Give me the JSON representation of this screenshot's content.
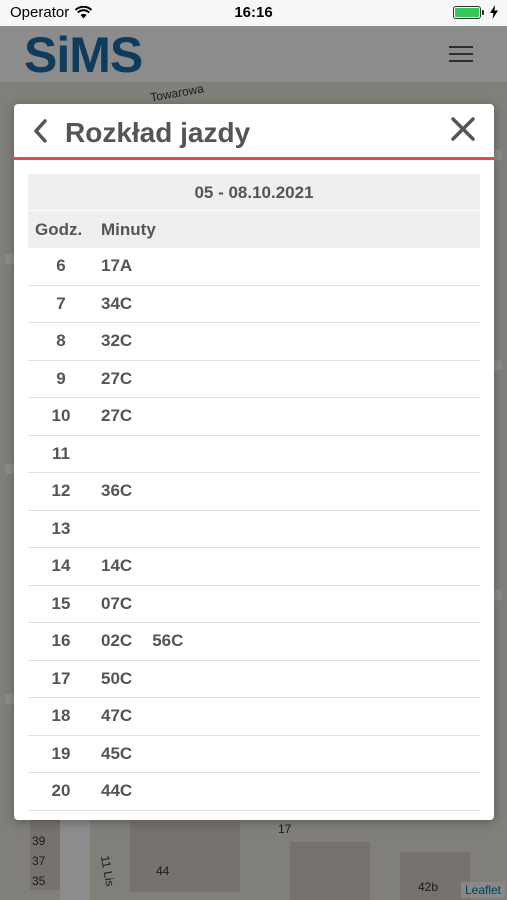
{
  "status_bar": {
    "carrier": "Operator",
    "time": "16:16"
  },
  "app": {
    "logo": "SiMS"
  },
  "map": {
    "street_label": "Towarowa",
    "street_label_2": "11 Lis",
    "house_numbers": [
      "39",
      "37",
      "35",
      "17",
      "44",
      "42b"
    ],
    "attribution": "Leaflet"
  },
  "modal": {
    "title": "Rozkład jazdy",
    "date_range": "05 - 08.10.2021",
    "col_hour": "Godz.",
    "col_minutes": "Minuty",
    "rows": [
      {
        "hour": "6",
        "minutes": [
          "17A"
        ]
      },
      {
        "hour": "7",
        "minutes": [
          "34C"
        ]
      },
      {
        "hour": "8",
        "minutes": [
          "32C"
        ]
      },
      {
        "hour": "9",
        "minutes": [
          "27C"
        ]
      },
      {
        "hour": "10",
        "minutes": [
          "27C"
        ]
      },
      {
        "hour": "11",
        "minutes": []
      },
      {
        "hour": "12",
        "minutes": [
          "36C"
        ]
      },
      {
        "hour": "13",
        "minutes": []
      },
      {
        "hour": "14",
        "minutes": [
          "14C"
        ]
      },
      {
        "hour": "15",
        "minutes": [
          "07C"
        ]
      },
      {
        "hour": "16",
        "minutes": [
          "02C",
          "56C"
        ]
      },
      {
        "hour": "17",
        "minutes": [
          "50C"
        ]
      },
      {
        "hour": "18",
        "minutes": [
          "47C"
        ]
      },
      {
        "hour": "19",
        "minutes": [
          "45C"
        ]
      },
      {
        "hour": "20",
        "minutes": [
          "44C"
        ]
      }
    ]
  },
  "colors": {
    "accent": "#e04a4a",
    "logo": "#1d6ea8",
    "battery": "#34c759"
  }
}
